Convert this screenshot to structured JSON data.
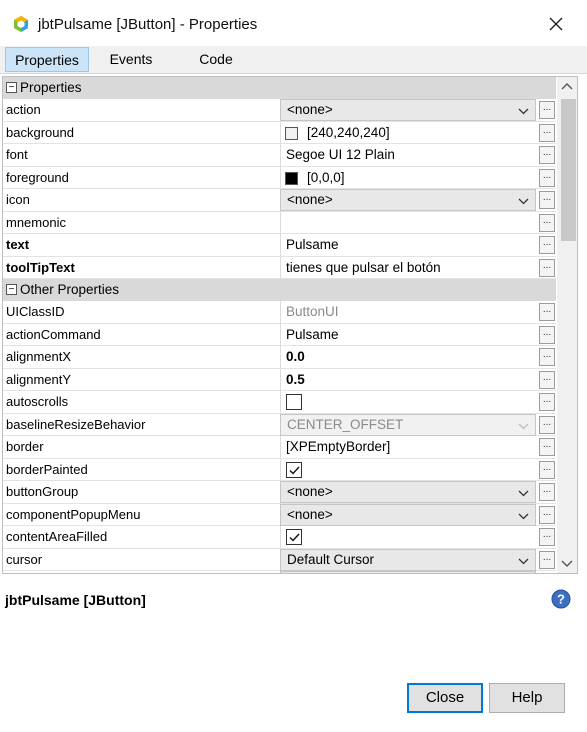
{
  "window": {
    "title": "jbtPulsame [JButton] - Properties"
  },
  "tabs": [
    {
      "label": "Properties",
      "active": true
    },
    {
      "label": "Events",
      "active": false
    },
    {
      "label": "Code",
      "active": false
    }
  ],
  "sections": {
    "properties": {
      "label": "Properties",
      "toggle": "−"
    },
    "other": {
      "label": "Other Properties",
      "toggle": "−"
    }
  },
  "rows": [
    {
      "name": "action",
      "value": "<none>",
      "kind": "combo"
    },
    {
      "name": "background",
      "value": "[240,240,240]",
      "kind": "color",
      "swatch": "#f0f0f0"
    },
    {
      "name": "font",
      "value": "Segoe UI 12 Plain",
      "kind": "text"
    },
    {
      "name": "foreground",
      "value": "[0,0,0]",
      "kind": "color",
      "swatch": "#000000"
    },
    {
      "name": "icon",
      "value": "<none>",
      "kind": "combo"
    },
    {
      "name": "mnemonic",
      "value": "",
      "kind": "text"
    },
    {
      "name": "text",
      "value": "Pulsame",
      "kind": "text",
      "bold_name": true
    },
    {
      "name": "toolTipText",
      "value": "tienes que pulsar el botón",
      "kind": "text",
      "bold_name": true
    },
    {
      "name": "UIClassID",
      "value": "ButtonUI",
      "kind": "readonly"
    },
    {
      "name": "actionCommand",
      "value": "Pulsame",
      "kind": "text"
    },
    {
      "name": "alignmentX",
      "value": "0.0",
      "kind": "text",
      "bold_value": true
    },
    {
      "name": "alignmentY",
      "value": "0.5",
      "kind": "text",
      "bold_value": true
    },
    {
      "name": "autoscrolls",
      "value": "",
      "kind": "checkbox",
      "checked": false
    },
    {
      "name": "baselineResizeBehavior",
      "value": "CENTER_OFFSET",
      "kind": "combo-disabled"
    },
    {
      "name": "border",
      "value": "[XPEmptyBorder]",
      "kind": "text"
    },
    {
      "name": "borderPainted",
      "value": "",
      "kind": "checkbox",
      "checked": true
    },
    {
      "name": "buttonGroup",
      "value": "<none>",
      "kind": "combo"
    },
    {
      "name": "componentPopupMenu",
      "value": "<none>",
      "kind": "combo"
    },
    {
      "name": "contentAreaFilled",
      "value": "",
      "kind": "checkbox",
      "checked": true
    },
    {
      "name": "cursor",
      "value": "Default Cursor",
      "kind": "combo"
    }
  ],
  "editor_button_label": "...",
  "description": {
    "text": "jbtPulsame [JButton]"
  },
  "buttons": {
    "close": "Close",
    "help": "Help"
  },
  "colors": {
    "active_tab_bg": "#cce4f7",
    "section_bg": "#d9d9d9",
    "default_button_border": "#0078d7"
  }
}
